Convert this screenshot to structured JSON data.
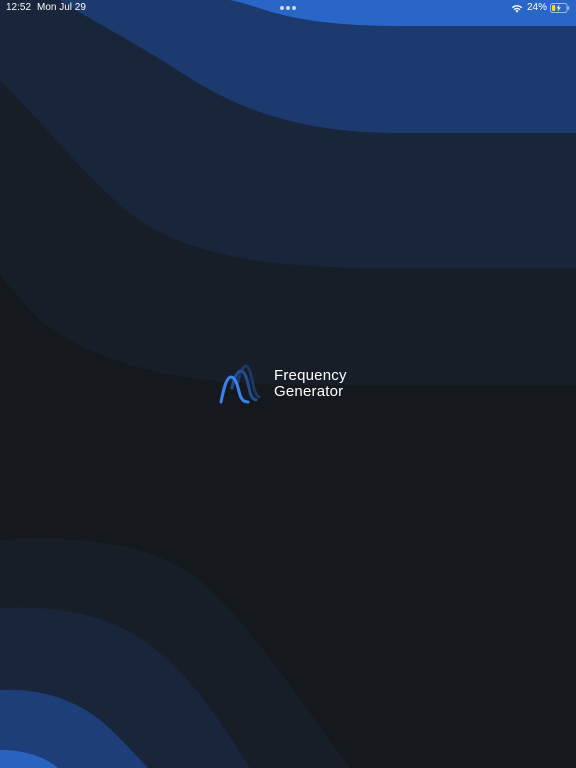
{
  "status_bar": {
    "time": "12:52",
    "date": "Mon Jul 29",
    "battery_percent": "24%",
    "battery_level": 0.24,
    "charging": true,
    "icons": [
      "wifi-icon",
      "battery-icon",
      "multitask-dots-icon"
    ]
  },
  "splash": {
    "app_name_line1": "Frequency",
    "app_name_line2": "Generator",
    "logo_icon": "waveform-icon"
  },
  "colors": {
    "background": "#15191d",
    "band_dark": "#18212d",
    "band_mid": "#1a2a47",
    "band_blue": "#1e4a93",
    "band_bright": "#2a66c8",
    "logo_blue": "#3b82f0",
    "text": "#ffffff"
  }
}
